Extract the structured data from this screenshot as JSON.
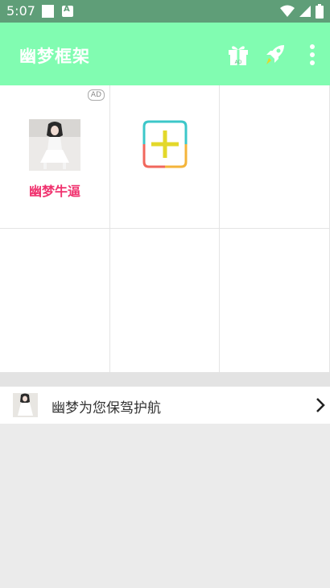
{
  "status_bar": {
    "time": "5:07",
    "notification_letter": "A"
  },
  "app_bar": {
    "title": "幽梦框架",
    "icons": [
      "gift-ad-icon",
      "rocket-icon",
      "more-vert-icon"
    ],
    "gift_badge": "AD"
  },
  "grid": {
    "ad_badge": "AD",
    "apps": [
      {
        "label": "幽梦牛逼"
      }
    ],
    "add_icon": "plus-icon"
  },
  "guard": {
    "text": "幽梦为您保驾护航"
  },
  "colors": {
    "status_bar": "#5f9e78",
    "app_bar": "#81fcb1",
    "app_label": "#f0336f",
    "plus": "#e3d82a"
  }
}
